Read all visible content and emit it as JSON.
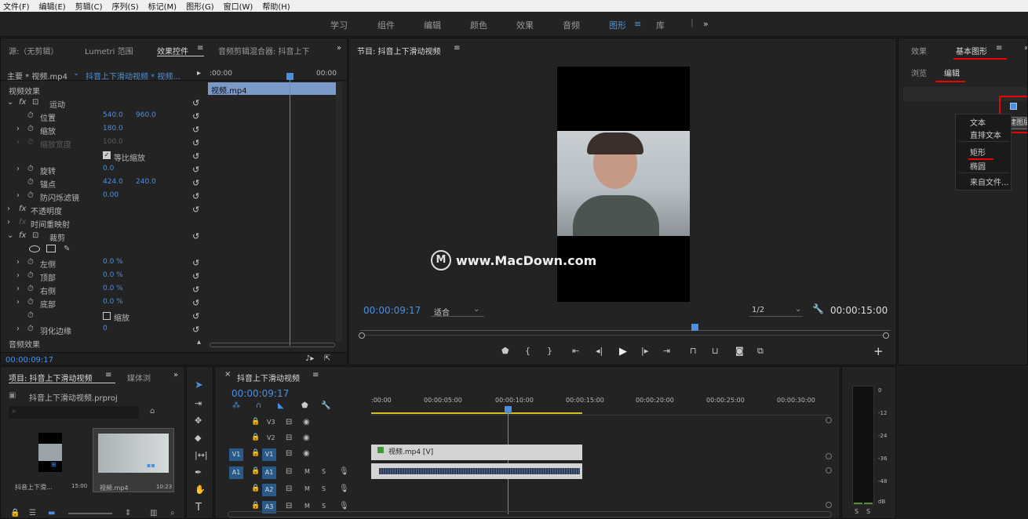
{
  "menu": [
    "文件(F)",
    "编辑(E)",
    "剪辑(C)",
    "序列(S)",
    "标记(M)",
    "图形(G)",
    "窗口(W)",
    "帮助(H)"
  ],
  "workspaces": [
    "学习",
    "组件",
    "编辑",
    "颜色",
    "效果",
    "音频",
    "图形",
    "库"
  ],
  "workspace_active": "图形",
  "source_panel": {
    "tabs": [
      "源:（无剪辑）",
      "Lumetri 范围",
      "效果控件",
      "音频剪辑混合器: 抖音上下"
    ],
    "active_tab": "效果控件",
    "master_clip": "主要 * 视频.mp4",
    "sequence_clip": "抖音上下滑动视频 * 视频...",
    "ruler_start": ":00:00",
    "ruler_end": "00:00",
    "clip_label": "视频.mp4",
    "section_video": "视频效果",
    "motion": "运动",
    "position_label": "位置",
    "position_x": "540.0",
    "position_y": "960.0",
    "scale_label": "缩放",
    "scale_value": "180.0",
    "scale_width_label": "缩放宽度",
    "scale_width_value": "100.0",
    "uniform_scale": "等比缩放",
    "rotation_label": "旋转",
    "rotation_value": "0.0",
    "anchor_label": "锚点",
    "anchor_x": "424.0",
    "anchor_y": "240.0",
    "flicker_label": "防闪烁滤镜",
    "flicker_value": "0.00",
    "opacity": "不透明度",
    "time_remap": "时间重映射",
    "crop": "裁剪",
    "left_label": "左侧",
    "left_value": "0.0 %",
    "top_label": "顶部",
    "top_value": "0.0 %",
    "right_label": "右侧",
    "right_value": "0.0 %",
    "bottom_label": "底部",
    "bottom_value": "0.0 %",
    "zoom_label": "缩放",
    "feather_label": "羽化边缘",
    "feather_value": "0",
    "section_audio": "音频效果",
    "timecode": "00:00:09:17"
  },
  "program_panel": {
    "title": "节目: 抖音上下滑动视频",
    "watermark": "www.MacDown.com",
    "timecode": "00:00:09:17",
    "fit": "适合",
    "resolution": "1/2",
    "duration": "00:00:15:00",
    "playhead_fraction": 0.63
  },
  "graphics_panel": {
    "tabs": [
      "效果",
      "基本图形"
    ],
    "active_tab": "基本图形",
    "subtabs": [
      "浏览",
      "编辑"
    ],
    "active_subtab": "编辑",
    "tooltip": "新建图层",
    "menu_items": [
      "文本",
      "直排文本",
      "矩形",
      "椭圆",
      "来自文件..."
    ]
  },
  "project_panel": {
    "tabs": [
      "项目: 抖音上下滑动视频",
      "媒体浏"
    ],
    "project_file": "抖音上下滑动视频.prproj",
    "items": [
      {
        "name": "抖音上下滑...",
        "duration": "15:00"
      },
      {
        "name": "视频.mp4",
        "duration": "10:23"
      }
    ]
  },
  "timeline_panel": {
    "title": "抖音上下滑动视频",
    "timecode": "00:00:09:17",
    "ruler": [
      ":00:00",
      "00:00:05:00",
      "00:00:10:00",
      "00:00:15:00",
      "00:00:20:00",
      "00:00:25:00",
      "00:00:30:00"
    ],
    "video_tracks": [
      "V3",
      "V2",
      "V1"
    ],
    "audio_tracks": [
      "A1",
      "A2",
      "A3"
    ],
    "source_v": "V1",
    "source_a": "A1",
    "video_clip": "视频.mp4 [V]",
    "mute": "M",
    "solo": "S"
  },
  "audio_meter": {
    "scale": [
      "0",
      "-12",
      "-24",
      "-36",
      "-48",
      "dB"
    ],
    "solo": "S"
  },
  "colors": {
    "accent": "#4a90e2",
    "highlight_red": "#e00000",
    "clip_selected": "#7a9ac8"
  }
}
